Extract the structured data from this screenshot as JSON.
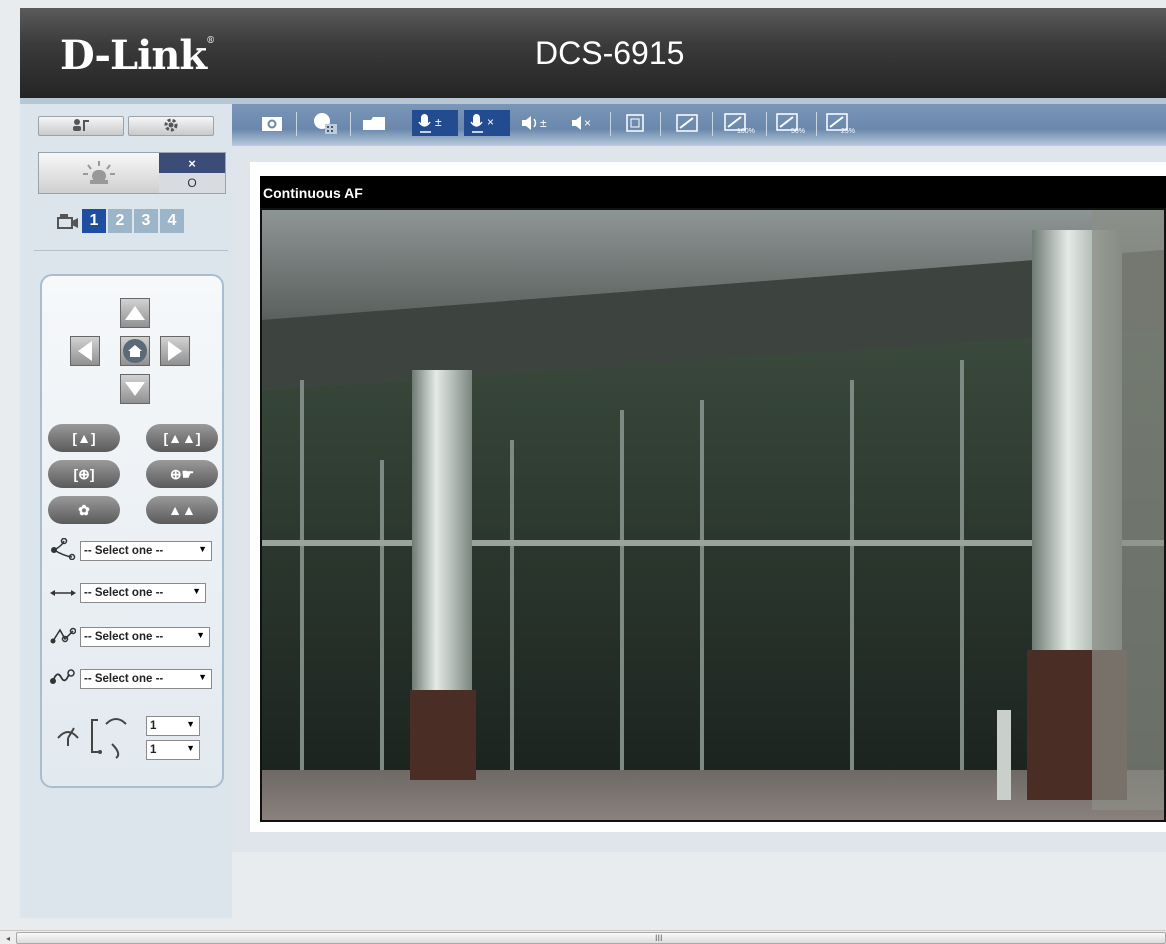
{
  "header": {
    "logo": "D-Link",
    "logo_mark": "®",
    "model": "DCS-6915"
  },
  "sidebar": {
    "user_icon": "user-key-icon",
    "setup_icon": "gear-icon",
    "alarm": {
      "light_icon": "alarm-light-icon",
      "off_label": "×",
      "on_label": "O"
    },
    "camera_icon": "camera-icon",
    "cameras": [
      "1",
      "2",
      "3",
      "4"
    ],
    "active_camera": "1"
  },
  "ptz": {
    "directions": {
      "up": "▲",
      "left": "◀",
      "home": "⌂",
      "right": "▶",
      "down": "▼"
    },
    "buttons": {
      "zoom_in": "[▲]",
      "zoom_out": "[▲▲]",
      "focus": "[⊕]",
      "click": "⊕☛",
      "near": "✿",
      "far": "▲▲"
    },
    "preset": {
      "icon": "preset-path-icon",
      "value": "-- Select one --"
    },
    "patrol": {
      "icon": "pan-arrows-icon",
      "value": "-- Select one --"
    },
    "sequence": {
      "icon": "sequence-path-icon",
      "value": "-- Select one --"
    },
    "cruise": {
      "icon": "cruise-path-icon",
      "value": "-- Select one --"
    },
    "speed": {
      "icon": "speed-gauge-icon",
      "pan_value": "1",
      "tilt_value": "1"
    }
  },
  "toolbar": {
    "items": [
      {
        "name": "snapshot-icon",
        "glyph": "◘"
      },
      {
        "name": "record-icon",
        "glyph": "●"
      },
      {
        "name": "folder-icon",
        "glyph": "▬"
      },
      {
        "name": "mic-on-icon",
        "glyph": "🎤±"
      },
      {
        "name": "mic-mute-icon",
        "glyph": "🎤×"
      },
      {
        "name": "speaker-volume-icon",
        "glyph": "◀)±"
      },
      {
        "name": "speaker-mute-icon",
        "glyph": "◀×"
      },
      {
        "name": "fullscreen-icon",
        "glyph": "⛶"
      },
      {
        "name": "resize-icon",
        "glyph": "⇗"
      },
      {
        "name": "zoom-100-icon",
        "glyph": "100%"
      },
      {
        "name": "zoom-50-icon",
        "glyph": "50%"
      },
      {
        "name": "zoom-25-icon",
        "glyph": "25%"
      }
    ]
  },
  "video": {
    "title": "Continuous AF"
  },
  "scrollbar": {
    "left_arrow": "◂",
    "grip": "III"
  }
}
